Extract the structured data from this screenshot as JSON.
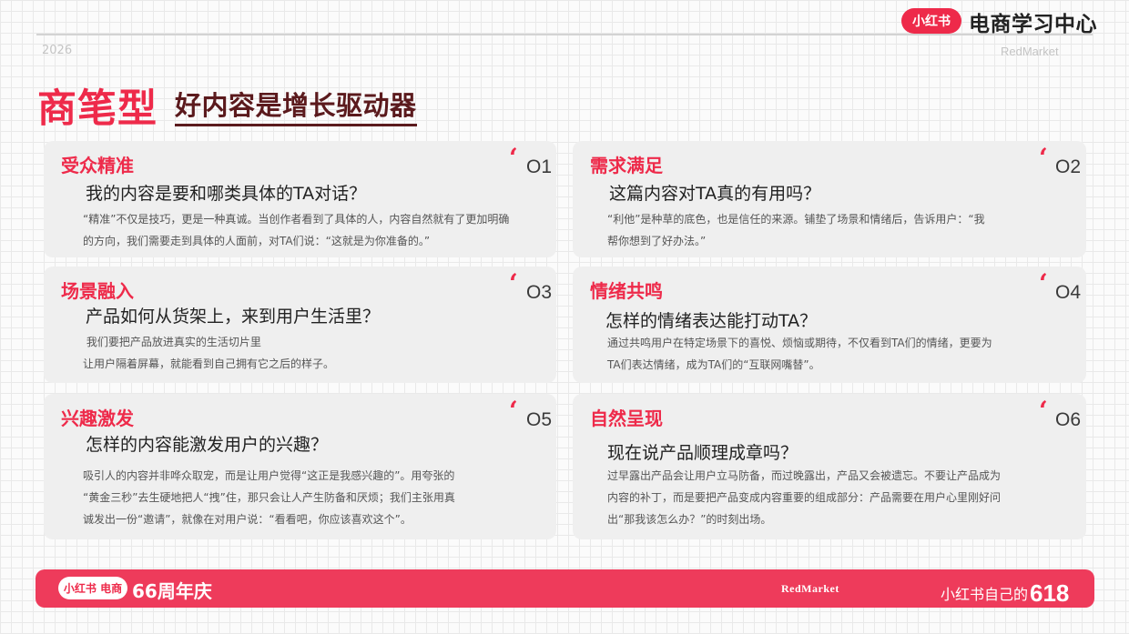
{
  "header": {
    "year": "2026",
    "brand_logo": "小红书",
    "brand_title": "电商学习中心",
    "watermark": "RedMarket"
  },
  "title": {
    "main": "商笔型",
    "sub": "好内容是增长驱动器"
  },
  "cards": [
    {
      "title": "受众精准",
      "num": "O1",
      "question": "我的内容是要和哪类具体的TA对话？",
      "lines": [
        "“精准”不仅是技巧，更是一种真诚。当创作者看到了具体的人，内容自然就有了更加明确",
        "的方向，我们需要走到具体的人面前，对TA们说：“这就是为你准备的。”"
      ]
    },
    {
      "title": "需求满足",
      "num": "O2",
      "question": "这篇内容对TA真的有用吗？",
      "lines": [
        "“利他”是种草的底色，也是信任的来源。铺垫了场景和情绪后，告诉用户：“我",
        "帮你想到了好办法。”"
      ]
    },
    {
      "title": "场景融入",
      "num": "O3",
      "question": "产品如何从货架上，来到用户生活里？",
      "lines": [
        " 我们要把产品放进真实的生活切片里",
        "让用户隔着屏幕，就能看到自己拥有它之后的样子。"
      ]
    },
    {
      "title": "情绪共鸣",
      "num": "O4",
      "question": "怎样的情绪表达能打动TA？",
      "lines": [
        "通过共鸣用户在特定场景下的喜悦、烦恼或期待，不仅看到TA们的情绪，更要为",
        "TA们表达情绪，成为TA们的“互联网嘴替”。"
      ]
    },
    {
      "title": "兴趣激发",
      "num": "O5",
      "question": "怎样的内容能激发用户的兴趣？",
      "lines": [
        "吸引人的内容并非哗众取宠，而是让用户觉得“这正是我感兴趣的”。用夸张的",
        "“黄金三秒”去生硬地把人“拽”住，那只会让人产生防备和厌烦；我们主张用真",
        "诚发出一份“邀请”，就像在对用户说：“看看吧，你应该喜欢这个”。"
      ]
    },
    {
      "title": "自然呈现",
      "num": "O6",
      "question": "现在说产品顺理成章吗？",
      "lines": [
        "过早露出产品会让用户立马防备，而过晚露出，产品又会被遗忘。不要让产品成为",
        "内容的补丁，而是要把产品变成内容重要的组成部分：产品需要在用户心里刚好问",
        "出“那我该怎么办？”的时刻出场。"
      ]
    }
  ],
  "quote_mark": "‘",
  "footer": {
    "logo": "小红书 电商",
    "anniversary": "66周年庆",
    "watermark": "RedMarket",
    "right_text": "小红书自己的",
    "right_num": "618"
  },
  "colors": {
    "accent": "#ee2a4a",
    "footer_bg": "#ee3b5b",
    "subtitle": "#5b1a1d",
    "card_bg": "#efefef"
  }
}
